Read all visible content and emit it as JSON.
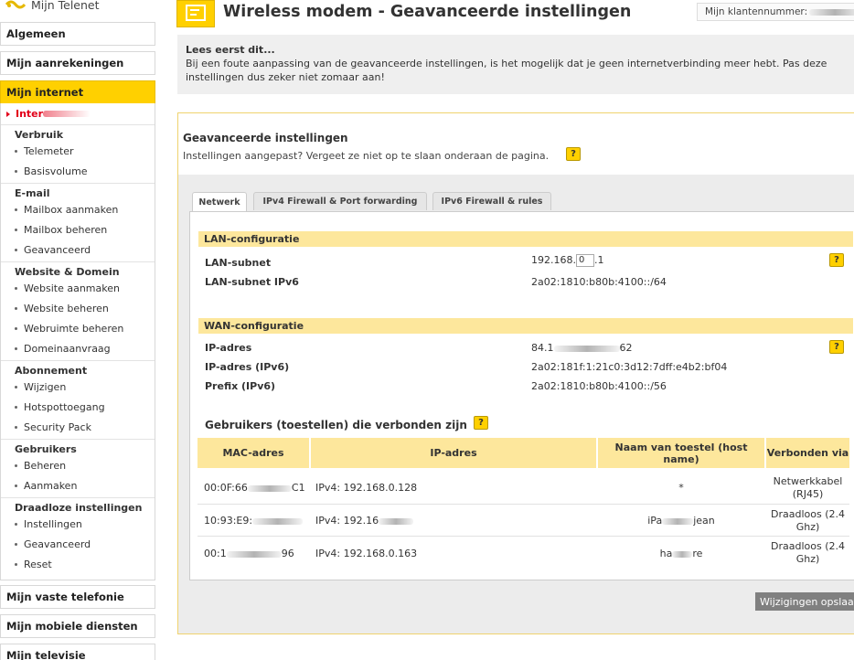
{
  "sidebar": {
    "brand": "Mijn Telenet",
    "sections_top": [
      "Algemeen",
      "Mijn aanrekeningen"
    ],
    "active_section": "Mijn internet",
    "current_item": "Inter",
    "groups": [
      {
        "title": "Verbruik",
        "items": [
          "Telemeter",
          "Basisvolume"
        ]
      },
      {
        "title": "E-mail",
        "items": [
          "Mailbox aanmaken",
          "Mailbox beheren",
          "Geavanceerd"
        ]
      },
      {
        "title": "Website & Domein",
        "items": [
          "Website aanmaken",
          "Website beheren",
          "Webruimte beheren",
          "Domeinaanvraag"
        ]
      },
      {
        "title": "Abonnement",
        "items": [
          "Wijzigen",
          "Hotspottoegang",
          "Security Pack"
        ]
      },
      {
        "title": "Gebruikers",
        "items": [
          "Beheren",
          "Aanmaken"
        ]
      },
      {
        "title": "Draadloze instellingen",
        "items": [
          "Instellingen",
          "Geavanceerd",
          "Reset"
        ]
      }
    ],
    "sections_bottom": [
      "Mijn vaste telefonie",
      "Mijn mobiele diensten",
      "Mijn televisie"
    ]
  },
  "header": {
    "title": "Wireless modem - Geavanceerde instellingen",
    "customer_label": "Mijn klantennummer:"
  },
  "notice": {
    "heading": "Lees eerst dit...",
    "text": "Bij een foute aanpassing van de geavanceerde instellingen, is het mogelijk dat je geen internetverbinding meer hebt. Pas deze instellingen dus zeker niet zomaar aan!"
  },
  "main": {
    "title": "Geavanceerde instellingen",
    "subtitle": "Instellingen aangepast? Vergeet ze niet op te slaan onderaan de pagina.",
    "help_glyph": "?",
    "tabs": [
      "Netwerk",
      "IPv4 Firewall & Port forwarding",
      "IPv6 Firewall & rules"
    ]
  },
  "lan": {
    "heading": "LAN-configuratie",
    "subnet_label": "LAN-subnet",
    "subnet_prefix": "192.168.",
    "subnet_input": "0",
    "subnet_suffix": ".1",
    "subnet_v6_label": "LAN-subnet IPv6",
    "subnet_v6_value": "2a02:1810:b80b:4100::/64"
  },
  "wan": {
    "heading": "WAN-configuratie",
    "ip_label": "IP-adres",
    "ip_start": "84.1",
    "ip_end": "62",
    "ipv6_label": "IP-adres (IPv6)",
    "ipv6_value": "2a02:181f:1:21c0:3d12:7dff:e4b2:bf04",
    "prefix_label": "Prefix (IPv6)",
    "prefix_value": "2a02:1810:b80b:4100::/56"
  },
  "devices": {
    "heading": "Gebruikers (toestellen) die verbonden zijn",
    "columns": [
      "MAC-adres",
      "IP-adres",
      "Naam van toestel (host name)",
      "Verbonden via"
    ],
    "rows": [
      {
        "mac_start": "00:0F:66",
        "mac_end": "C1",
        "ip": "IPv4: 192.168.0.128",
        "ip_end": "",
        "name_start": "*",
        "name_end": "",
        "via": "Netwerkkabel (RJ45)"
      },
      {
        "mac_start": "10:93:E9:",
        "mac_end": "",
        "ip": "IPv4: 192.16",
        "ip_end": "",
        "name_start": "iPa",
        "name_end": "jean",
        "via": "Draadloos (2.4 Ghz)"
      },
      {
        "mac_start": "00:1",
        "mac_end": "96",
        "ip": "IPv4: 192.168.0.163",
        "ip_end": "",
        "name_start": "ha",
        "name_end": "re",
        "via": "Draadloos (2.4 Ghz)"
      }
    ]
  },
  "save_button": "Wijzigingen opslaan"
}
